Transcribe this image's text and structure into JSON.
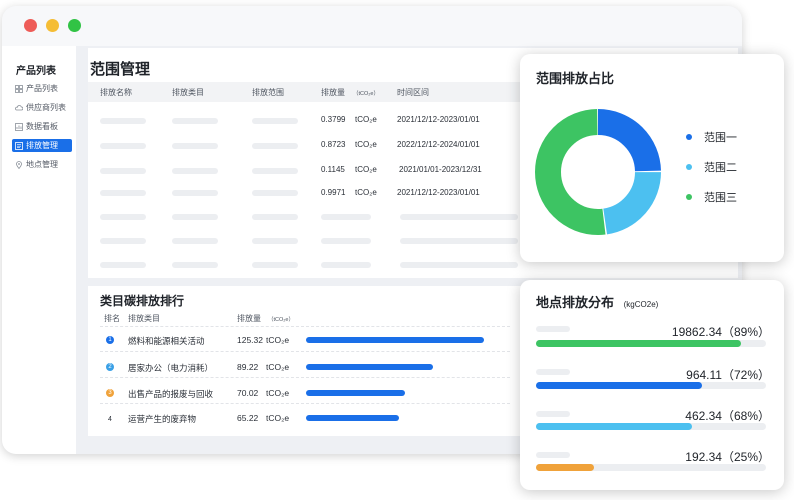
{
  "sidebar": {
    "title": "产品列表",
    "items": [
      {
        "label": "产品列表",
        "icon": "grid-icon",
        "active": false
      },
      {
        "label": "供应商列表",
        "icon": "cloud-icon",
        "active": false
      },
      {
        "label": "数据看板",
        "icon": "chart-icon",
        "active": false
      },
      {
        "label": "排放管理",
        "icon": "list-icon",
        "active": true
      },
      {
        "label": "地点管理",
        "icon": "location-icon",
        "active": false
      }
    ]
  },
  "main": {
    "title": "范围管理",
    "columns": [
      "排放名称",
      "排放类目",
      "排放范围",
      "排放量",
      "（tCO₂e）",
      "时间区间"
    ],
    "rows": [
      {
        "amount": "0.3799",
        "unit": "tCO₂e",
        "period": "2021/12/12-2023/01/01"
      },
      {
        "amount": "0.8723",
        "unit": "tCO₂e",
        "period": "2022/12/12-2024/01/01"
      },
      {
        "amount": "0.1145",
        "unit": "tCO₂e",
        "period": "2021/01/01-2023/12/31"
      },
      {
        "amount": "0.9971",
        "unit": "tCO₂e",
        "period": "2021/12/12-2023/01/01"
      }
    ]
  },
  "ranking": {
    "title": "类目碳排放排行",
    "col_rank": "排名",
    "col_category": "排放类目",
    "col_amount": "排放量",
    "col_unit": "（tCO₂e）",
    "items": [
      {
        "rank": "1",
        "name": "燃料和能源相关活动",
        "amount": "125.32",
        "unit": "tCO₂e",
        "value": 125.32,
        "color": "#1a6fe8"
      },
      {
        "rank": "2",
        "name": "居家办公（电力消耗）",
        "amount": "89.22",
        "unit": "tCO₂e",
        "value": 89.22,
        "color": "#3aa0e6"
      },
      {
        "rank": "3",
        "name": "出售产品的报废与回收",
        "amount": "70.02",
        "unit": "tCO₂e",
        "value": 70.02,
        "color": "#f0a23a"
      },
      {
        "rank": "4",
        "name": "运营产生的废弃物",
        "amount": "65.22",
        "unit": "tCO₂e",
        "value": 65.22,
        "color": "#ffffff"
      }
    ],
    "bar_color": "#1a6fe8"
  },
  "scope_panel": {
    "title": "范围排放占比",
    "legend": [
      {
        "label": "范围一",
        "color": "#1a6fe8"
      },
      {
        "label": "范围二",
        "color": "#4cc0f0"
      },
      {
        "label": "范围三",
        "color": "#3dc463"
      }
    ]
  },
  "location_panel": {
    "title": "地点排放分布",
    "unit": "(kgCO2e)",
    "items": [
      {
        "value": "19862.34",
        "percent_label": "（89%）",
        "fraction": 0.89,
        "color": "#3dc463"
      },
      {
        "value": "964.11",
        "percent_label": "（72%）",
        "fraction": 0.72,
        "color": "#1a6fe8"
      },
      {
        "value": "462.34",
        "percent_label": "（68%）",
        "fraction": 0.68,
        "color": "#4cc0f0"
      },
      {
        "value": "192.34",
        "percent_label": "（25%）",
        "fraction": 0.25,
        "color": "#f0a23a"
      }
    ]
  },
  "chart_data": {
    "type": "pie",
    "title": "范围排放占比",
    "categories": [
      "范围一",
      "范围二",
      "范围三"
    ],
    "values": [
      25,
      23,
      52
    ],
    "colors": [
      "#1a6fe8",
      "#4cc0f0",
      "#3dc463"
    ],
    "legend": "right"
  }
}
